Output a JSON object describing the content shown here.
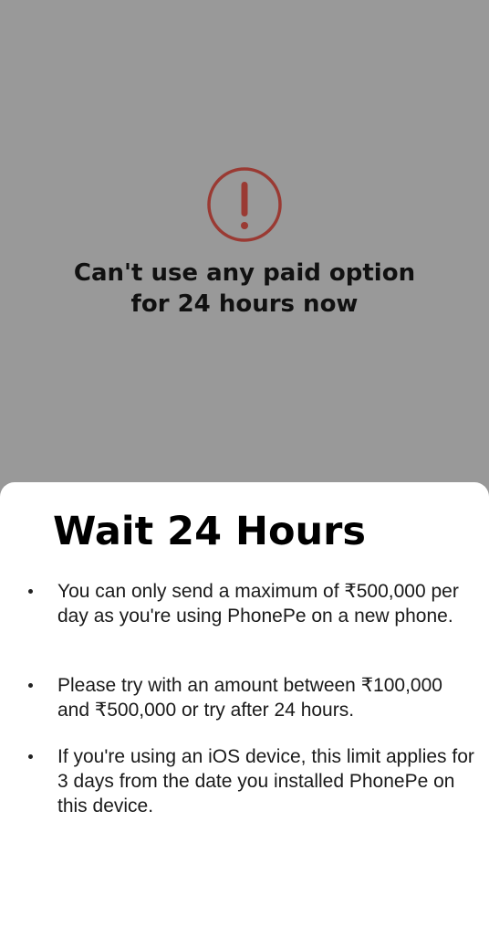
{
  "alert": {
    "icon": "exclamation-circle-icon",
    "icon_color": "#9a3a33",
    "title": "Can't use any paid option\nfor 24 hours now"
  },
  "sheet": {
    "title": "Wait 24 Hours",
    "bullets": [
      "You can only send a maximum of ₹500,000 per day as you're using PhonePe on a new phone.",
      "Please try with an amount between ₹100,000 and ₹500,000 or try after 24 hours.",
      "If you're using an iOS device, this limit applies for 3 days from the date you installed PhonePe on this device."
    ]
  },
  "colors": {
    "overlay": "#999999",
    "sheet_background": "#ffffff"
  }
}
